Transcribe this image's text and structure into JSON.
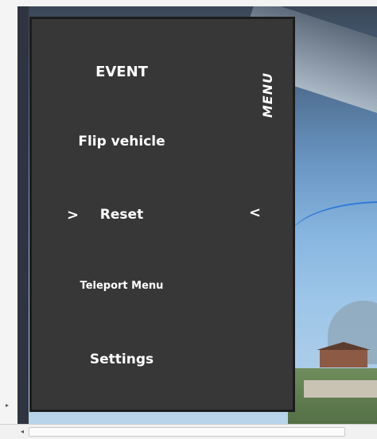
{
  "menu": {
    "title_vertical": "MENU",
    "items": [
      {
        "label": "EVENT"
      },
      {
        "label": "Flip vehicle"
      },
      {
        "label": "Reset"
      },
      {
        "label": "Teleport Menu"
      },
      {
        "label": "Settings"
      }
    ],
    "left_chevron": ">",
    "right_chevron": "<"
  },
  "chrome": {
    "left_arrow": "▸",
    "bottom_left_arrow": "◂"
  }
}
